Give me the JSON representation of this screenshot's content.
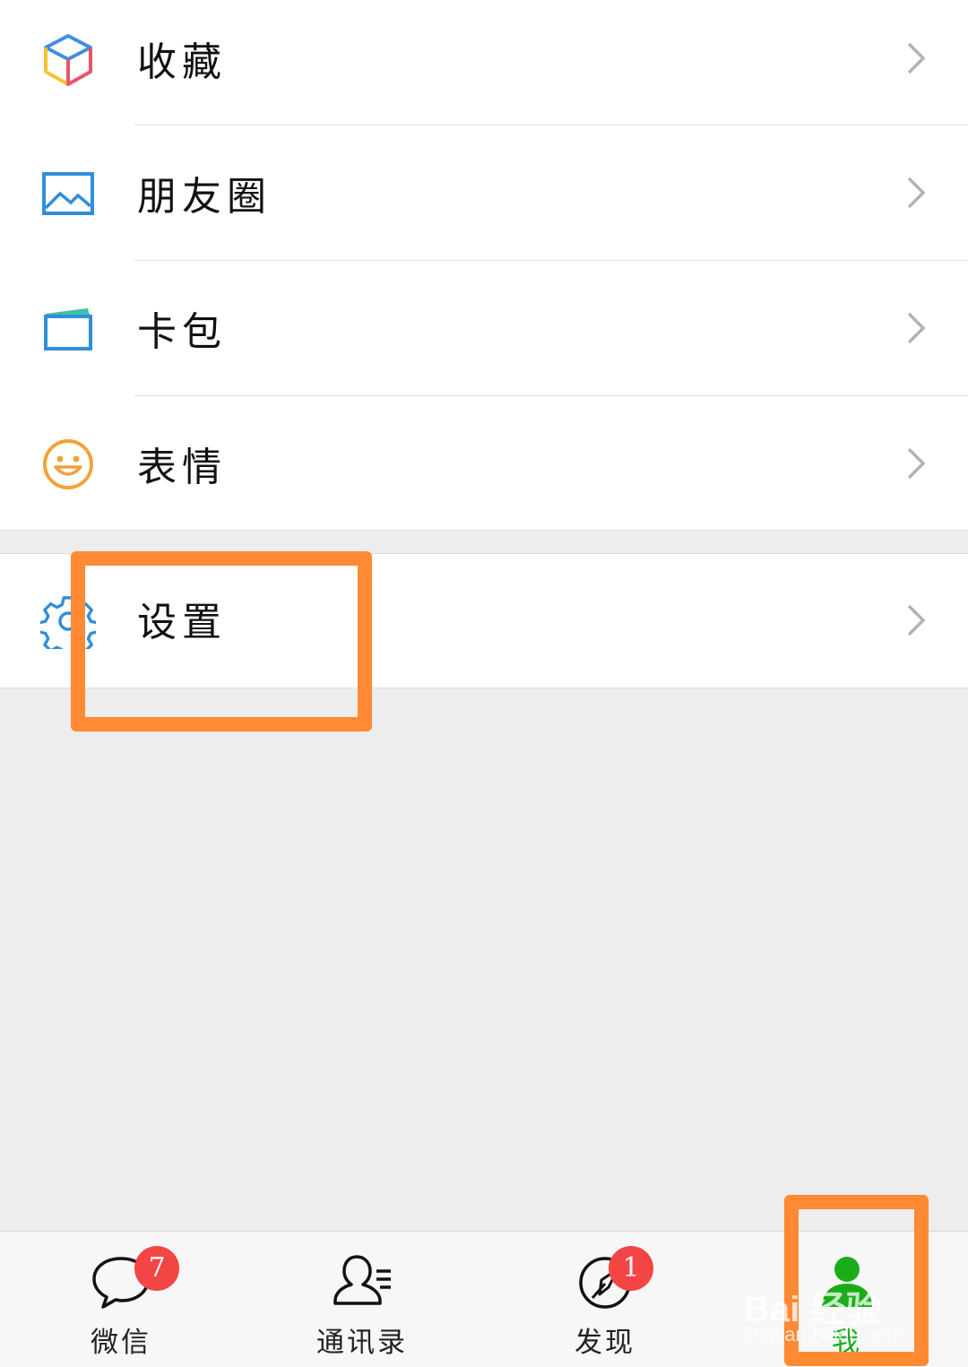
{
  "menu": {
    "items": [
      {
        "label": "收藏",
        "icon": "favorites-cube-icon"
      },
      {
        "label": "朋友圈",
        "icon": "moments-picture-icon"
      },
      {
        "label": "卡包",
        "icon": "card-wallet-icon"
      },
      {
        "label": "表情",
        "icon": "sticker-smiley-icon"
      }
    ],
    "settings": {
      "label": "设置",
      "icon": "gear-icon"
    }
  },
  "tabbar": {
    "tabs": [
      {
        "label": "微信",
        "badge": "7",
        "icon": "chat-bubble-icon"
      },
      {
        "label": "通讯录",
        "icon": "contacts-icon"
      },
      {
        "label": "发现",
        "badge": "1",
        "icon": "discover-compass-icon"
      },
      {
        "label": "我",
        "icon": "me-person-icon",
        "active": true
      }
    ]
  },
  "watermark": {
    "text": "Bai 经验",
    "sub": "jingyan.baidu.com"
  },
  "colors": {
    "accent_green": "#1aad19",
    "highlight_orange": "#ff8a33",
    "badge_red": "#f44545",
    "icon_blue": "#2f8fd8",
    "icon_orange": "#f2a23a"
  }
}
